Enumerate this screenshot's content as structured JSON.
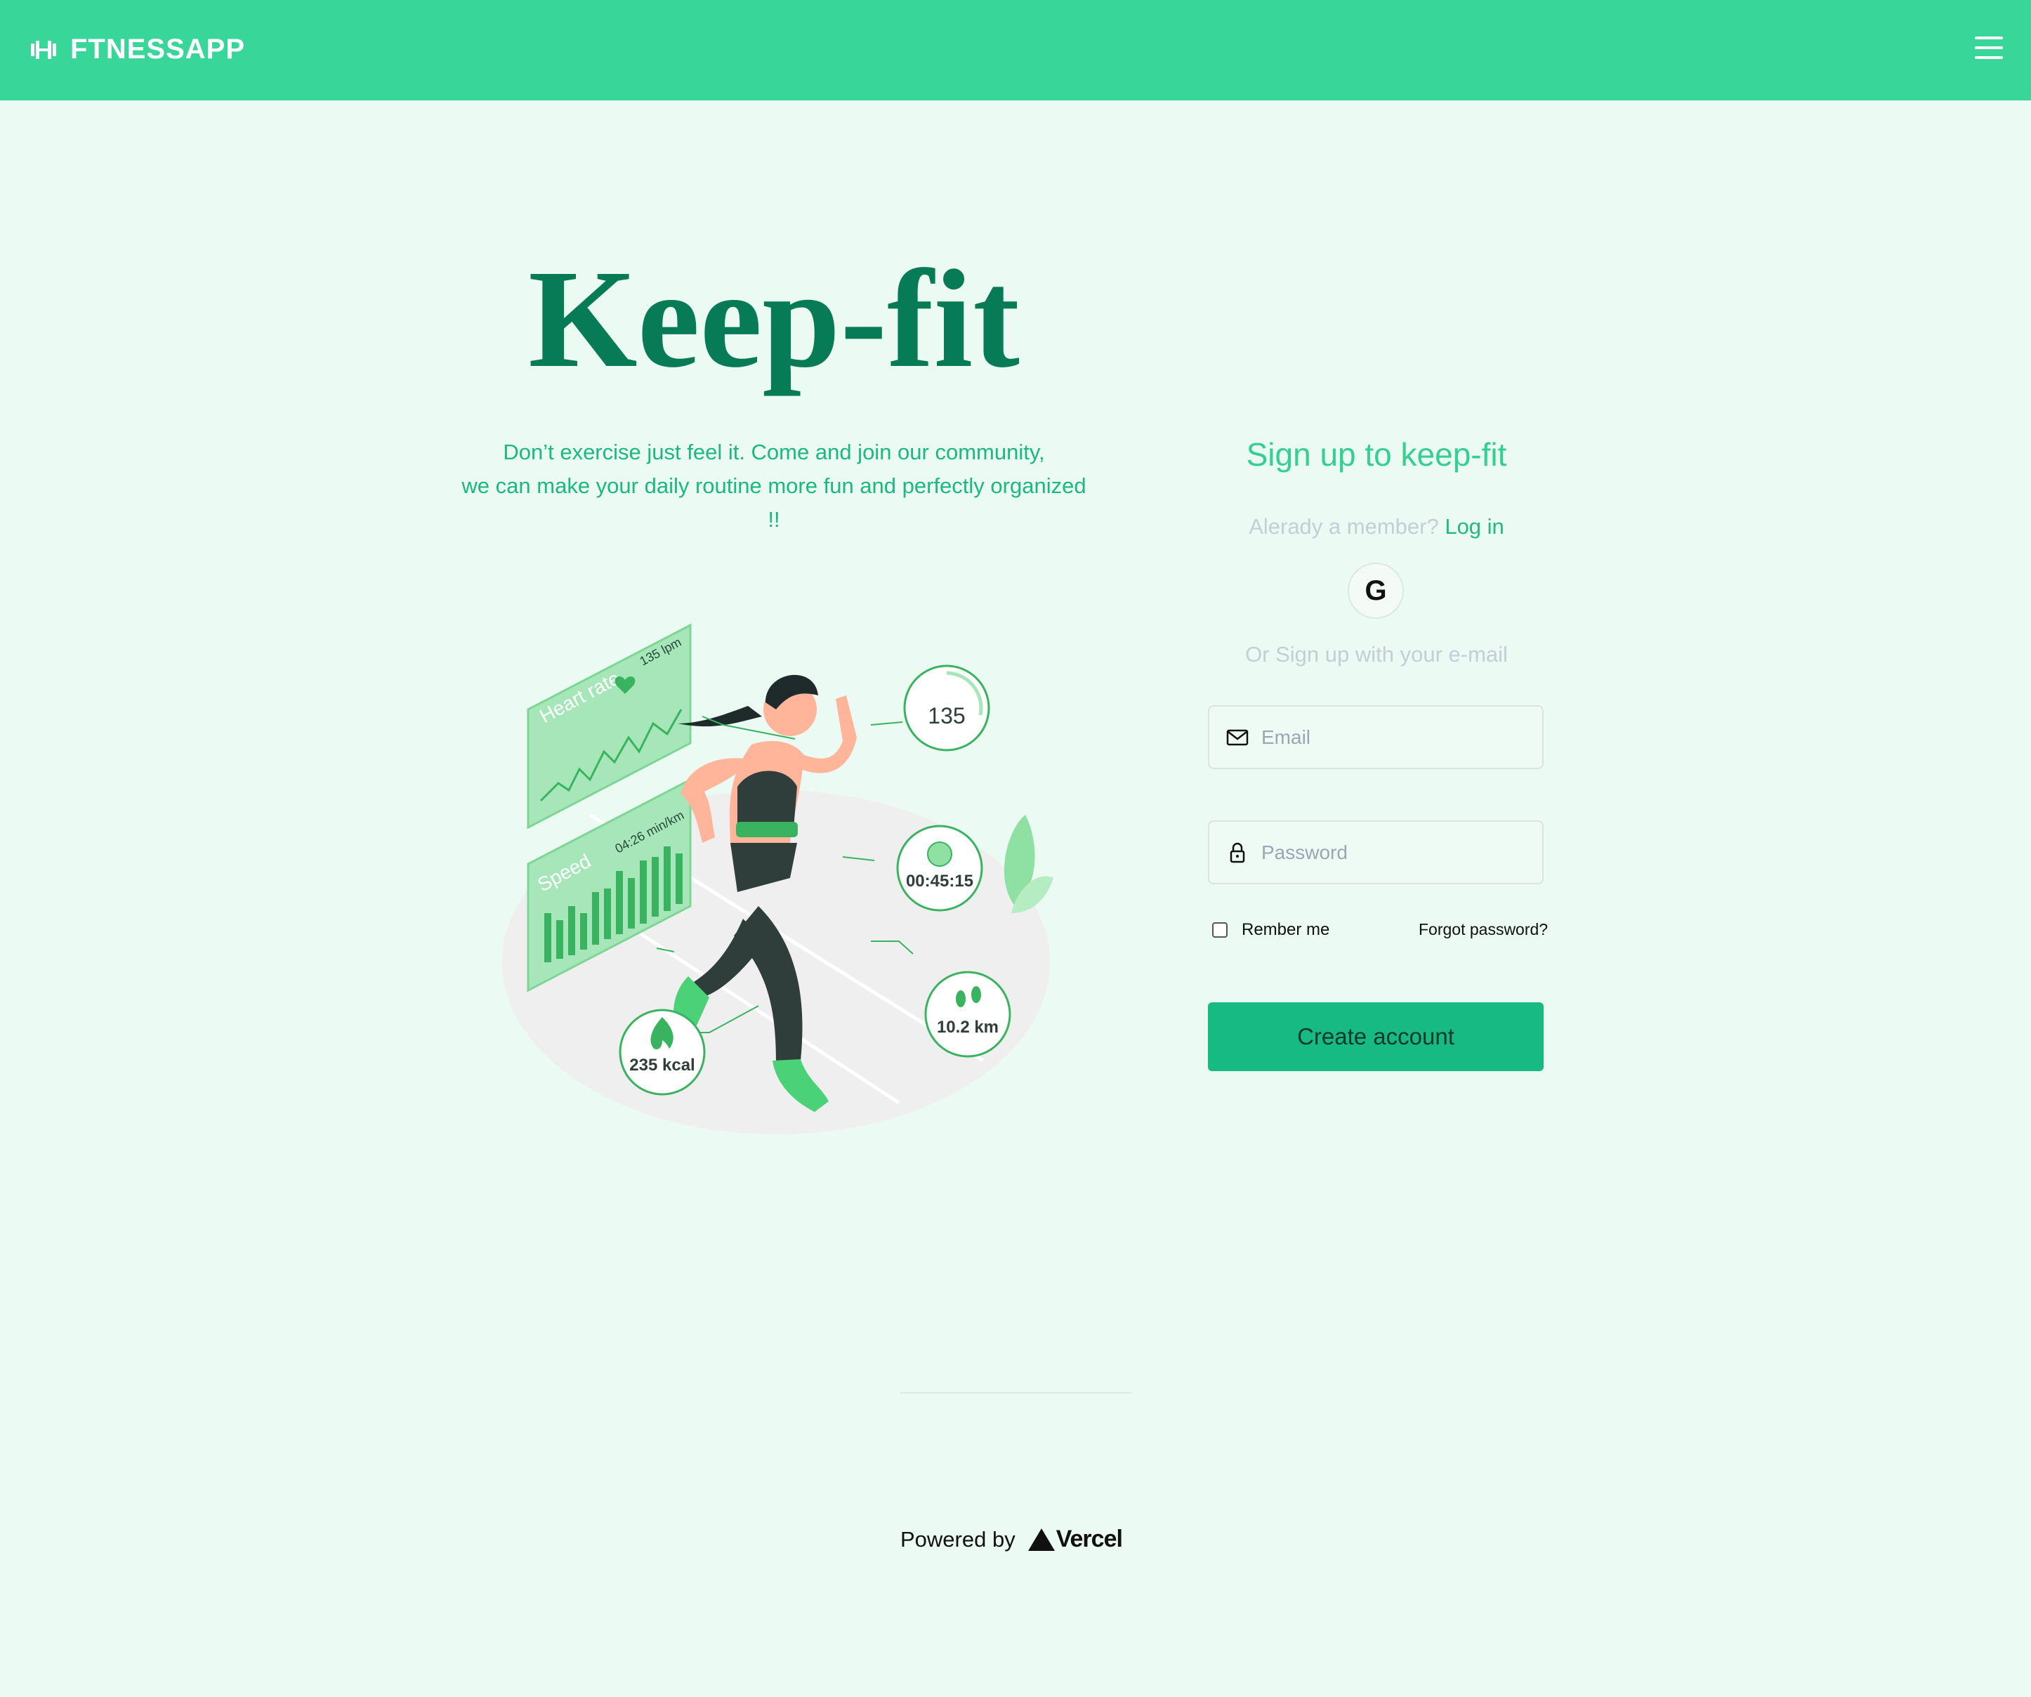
{
  "header": {
    "brand": "FTNESSAPP",
    "brand_icon": "dumbbell-icon",
    "menu_icon": "hamburger-menu-icon"
  },
  "hero": {
    "title": "Keep-fit",
    "subtitle_line1": "Don’t exercise just feel it. Come and join our community,",
    "subtitle_line2": "we can make your daily routine more fun and perfectly organized",
    "subtitle_line3": "!!"
  },
  "illustration": {
    "heart_rate_label": "Heart rate",
    "heart_rate_bpm": "135 lpm",
    "heart_rate_value": "135",
    "speed_label": "Speed",
    "pace": "04:26 min/km",
    "timer": "00:45:15",
    "distance": "10.2 km",
    "calories": "235 kcal"
  },
  "signup": {
    "title": "Sign up to keep-fit",
    "member_text": "Alerady a member?",
    "login_link": "Log in",
    "google_icon": "google-icon",
    "or_text": "Or Sign up with your e-mail",
    "email_placeholder": "Email",
    "password_placeholder": "Password",
    "remember_label": "Rember me",
    "forgot_label": "Forgot password?",
    "create_label": "Create account"
  },
  "footer": {
    "powered_by": "Powered by",
    "vercel": "Vercel"
  },
  "colors": {
    "topbar": "#38d699",
    "background": "#ebfaf2",
    "title": "#077a56",
    "accent": "#1bb981",
    "button": "#17ba83"
  }
}
